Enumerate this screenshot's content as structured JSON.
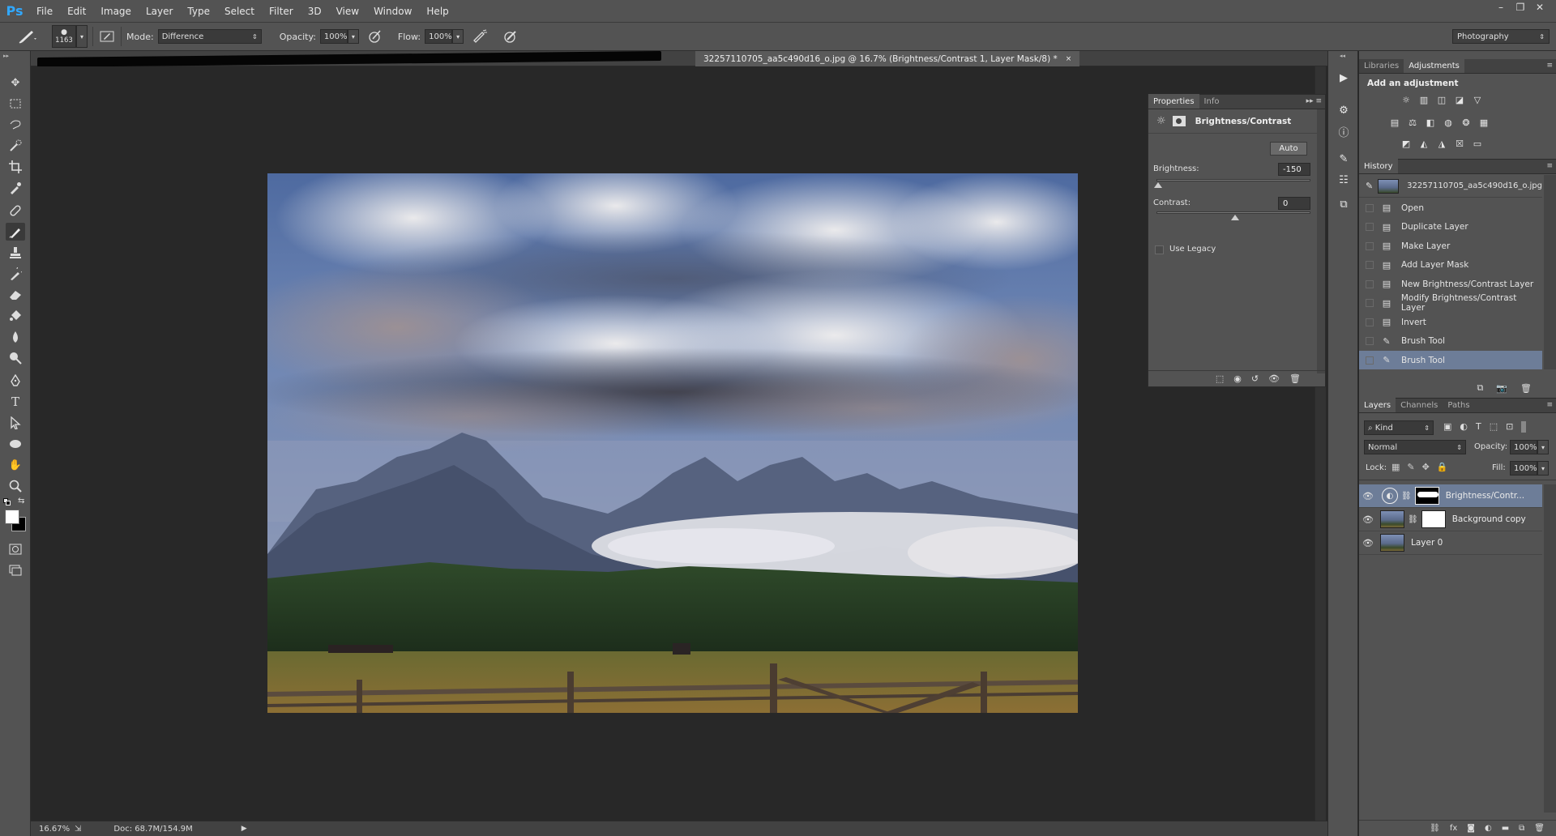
{
  "app": {
    "logo": "Ps"
  },
  "menu": [
    "File",
    "Edit",
    "Image",
    "Layer",
    "Type",
    "Select",
    "Filter",
    "3D",
    "View",
    "Window",
    "Help"
  ],
  "window_controls": {
    "minimize": "–",
    "restore": "❐",
    "close": "✕"
  },
  "options_bar": {
    "brush_size": "1163",
    "mode_label": "Mode:",
    "mode_value": "Difference",
    "opacity_label": "Opacity:",
    "opacity_value": "100%",
    "flow_label": "Flow:",
    "flow_value": "100%",
    "workspace": "Photography"
  },
  "document": {
    "tab_title": "32257110705_aa5c490d16_o.jpg @ 16.7% (Brightness/Contrast 1, Layer Mask/8) *",
    "tab_close": "×"
  },
  "status": {
    "zoom": "16.67%",
    "doc_info": "Doc: 68.7M/154.9M"
  },
  "properties": {
    "tabs": [
      "Properties",
      "Info"
    ],
    "title": "Brightness/Contrast",
    "auto_button": "Auto",
    "brightness_label": "Brightness:",
    "brightness_value": "-150",
    "brightness_fraction": 0.0,
    "contrast_label": "Contrast:",
    "contrast_value": "0",
    "contrast_fraction": 0.5,
    "use_legacy_label": "Use Legacy",
    "use_legacy_checked": false
  },
  "adjustments": {
    "tabs": [
      "Libraries",
      "Adjustments"
    ],
    "heading": "Add an adjustment"
  },
  "history": {
    "title": "History",
    "snapshot": "32257110705_aa5c490d16_o.jpg",
    "items": [
      {
        "label": "Open",
        "icon": "doc-icon"
      },
      {
        "label": "Duplicate Layer",
        "icon": "doc-icon"
      },
      {
        "label": "Make Layer",
        "icon": "doc-icon"
      },
      {
        "label": "Add Layer Mask",
        "icon": "doc-icon"
      },
      {
        "label": "New Brightness/Contrast Layer",
        "icon": "doc-icon"
      },
      {
        "label": "Modify Brightness/Contrast Layer",
        "icon": "doc-icon"
      },
      {
        "label": "Invert",
        "icon": "doc-icon"
      },
      {
        "label": "Brush Tool",
        "icon": "brush-icon"
      },
      {
        "label": "Brush Tool",
        "icon": "brush-icon",
        "selected": true
      }
    ]
  },
  "layers": {
    "tabs": [
      "Layers",
      "Channels",
      "Paths"
    ],
    "filter_kind": "Kind",
    "blend_mode": "Normal",
    "opacity_label": "Opacity:",
    "opacity_value": "100%",
    "lock_label": "Lock:",
    "fill_label": "Fill:",
    "fill_value": "100%",
    "items": [
      {
        "name": "Brightness/Contr...",
        "selected": true,
        "type": "adjustment"
      },
      {
        "name": "Background copy",
        "selected": false,
        "type": "masked"
      },
      {
        "name": "Layer 0",
        "selected": false,
        "type": "plain"
      }
    ]
  },
  "colors": {
    "selection": "#6d7d98",
    "panel": "#535353",
    "canvas_bg": "#282828",
    "accent": "#31a8ff"
  }
}
